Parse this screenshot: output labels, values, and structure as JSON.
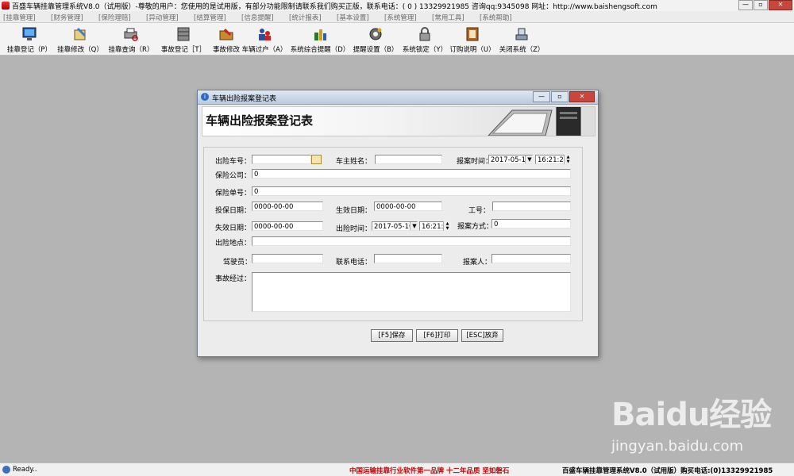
{
  "window": {
    "title": "百盛车辆挂靠管理系统V8.0（试用版）-尊敬的用户：您使用的是试用版，有部分功能限制请联系我们购买正版，联系电话：( 0 ) 13329921985  咨询qq:9345098   网址：http://www.baishengsoft.com",
    "controls": [
      "—",
      "▫",
      "✕"
    ]
  },
  "menu": [
    "[挂靠管理]",
    "[财务管理]",
    "[保险理赔]",
    "[异动管理]",
    "[结算管理]",
    "[信息提醒]",
    "[统计报表]",
    "[基本设置]",
    "[系统管理]",
    "[常用工具]",
    "[系统帮助]"
  ],
  "toolbar": [
    {
      "label": "挂靠登记（P）",
      "icon": "monitor-icon"
    },
    {
      "label": "挂靠修改（Q）",
      "icon": "book-edit-icon"
    },
    {
      "label": "挂靠查询（R）",
      "icon": "printer-search-icon"
    },
    {
      "label": "事故登记［T］",
      "icon": "cabinet-icon"
    },
    {
      "label": "事故修改",
      "icon": "folder-edit-icon"
    },
    {
      "label": "车辆过户（A）",
      "icon": "users-transfer-icon"
    },
    {
      "label": "系统综合提醒（D）",
      "icon": "bottles-icon"
    },
    {
      "label": "提醒设置（B）",
      "icon": "gear-icon"
    },
    {
      "label": "系统锁定（Y）",
      "icon": "lock-icon"
    },
    {
      "label": "订购说明（U）",
      "icon": "cash-book-icon"
    },
    {
      "label": "关闭系统（Z）",
      "icon": "shutdown-icon"
    }
  ],
  "dialog": {
    "title": "车辆出险报案登记表",
    "heading": "车辆出险报案登记表",
    "controls": [
      "—",
      "▫",
      "✕"
    ],
    "fields": {
      "plate_label": "出险车号：",
      "plate_value": "",
      "owner_label": "车主姓名：",
      "owner_value": "",
      "report_time_label": "报案时间：",
      "report_date": "2017-05-16",
      "report_clock": "16:21:25",
      "insurer_label": "保险公司：",
      "insurer_value": "0",
      "policy_label": "保险单号：",
      "policy_value": "0",
      "insure_date_label": "投保日期：",
      "insure_date_value": "0000-00-00",
      "effective_label": "生效日期：",
      "effective_value": "0000-00-00",
      "job_label": "工号：",
      "job_value": "",
      "expire_label": "失效日期：",
      "expire_value": "0000-00-00",
      "accident_time_label": "出险时间：",
      "accident_date": "2017-05-16",
      "accident_clock": "16:21:",
      "report_method_label": "报案方式：",
      "report_method_value": "0",
      "location_label": "出险地点：",
      "location_value": "",
      "driver_label": "驾驶员：",
      "driver_value": "",
      "phone_label": "联系电话：",
      "phone_value": "",
      "reporter_label": "报案人：",
      "reporter_value": "",
      "process_label": "事故经过：",
      "process_value": ""
    },
    "buttons": {
      "save": "[F5]保存",
      "print": "[F6]打印",
      "cancel": "[ESC]放弃"
    }
  },
  "status": {
    "ready": "Ready..",
    "slogan": "中国运输挂靠行业软件第一品牌   十二年品质 坚如磐石",
    "product": "百盛车辆挂靠管理系统V8.0（试用版）购买电话:(0)13329921985"
  },
  "watermark": {
    "brand": "Baidu经验",
    "url": "jingyan.baidu.com"
  }
}
